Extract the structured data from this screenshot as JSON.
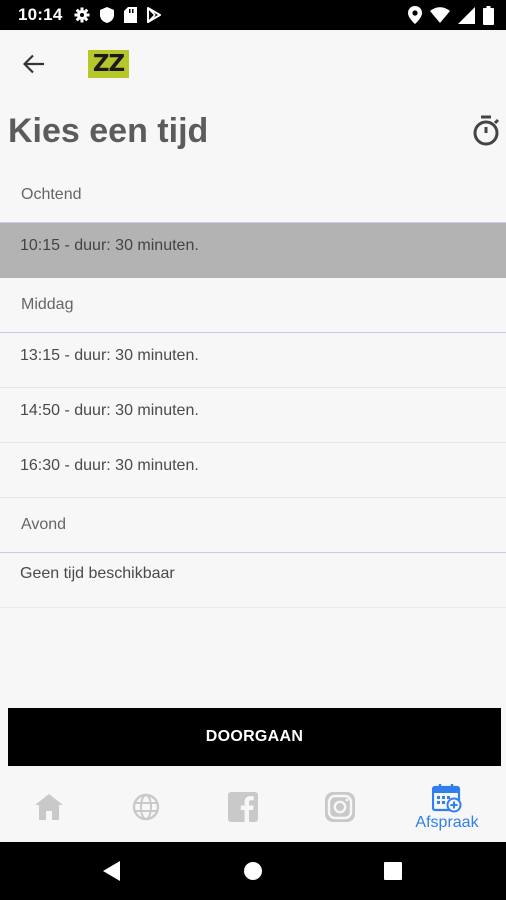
{
  "status_bar": {
    "time": "10:14",
    "left_icons": [
      "gear-icon",
      "shield-icon",
      "sd-card-icon",
      "play-store-icon"
    ],
    "right_icons": [
      "location-icon",
      "wifi-icon",
      "signal-icon",
      "battery-icon"
    ]
  },
  "header": {
    "logo_text": "ZZ",
    "logo_color": "#b7c72a"
  },
  "page": {
    "title": "Kies een tijd"
  },
  "sections": {
    "morning": {
      "header": "Ochtend",
      "slots": [
        {
          "label": "10:15 - duur: 30 minuten.",
          "selected": true
        }
      ]
    },
    "afternoon": {
      "header": "Middag",
      "slots": [
        {
          "label": "13:15 - duur: 30 minuten."
        },
        {
          "label": "14:50 - duur: 30 minuten."
        },
        {
          "label": "16:30 - duur: 30 minuten."
        }
      ]
    },
    "evening": {
      "header": "Avond",
      "empty_text": "Geen tijd beschikbaar"
    }
  },
  "actions": {
    "continue_label": "DOORGAAN"
  },
  "bottom_nav": {
    "items": [
      {
        "icon": "home-icon"
      },
      {
        "icon": "globe-icon"
      },
      {
        "icon": "facebook-icon"
      },
      {
        "icon": "instagram-icon"
      },
      {
        "icon": "calendar-add-icon",
        "label": "Afspraak",
        "active": true
      }
    ],
    "inactive_color": "#c9c9c9",
    "active_color": "#2f80ed"
  }
}
